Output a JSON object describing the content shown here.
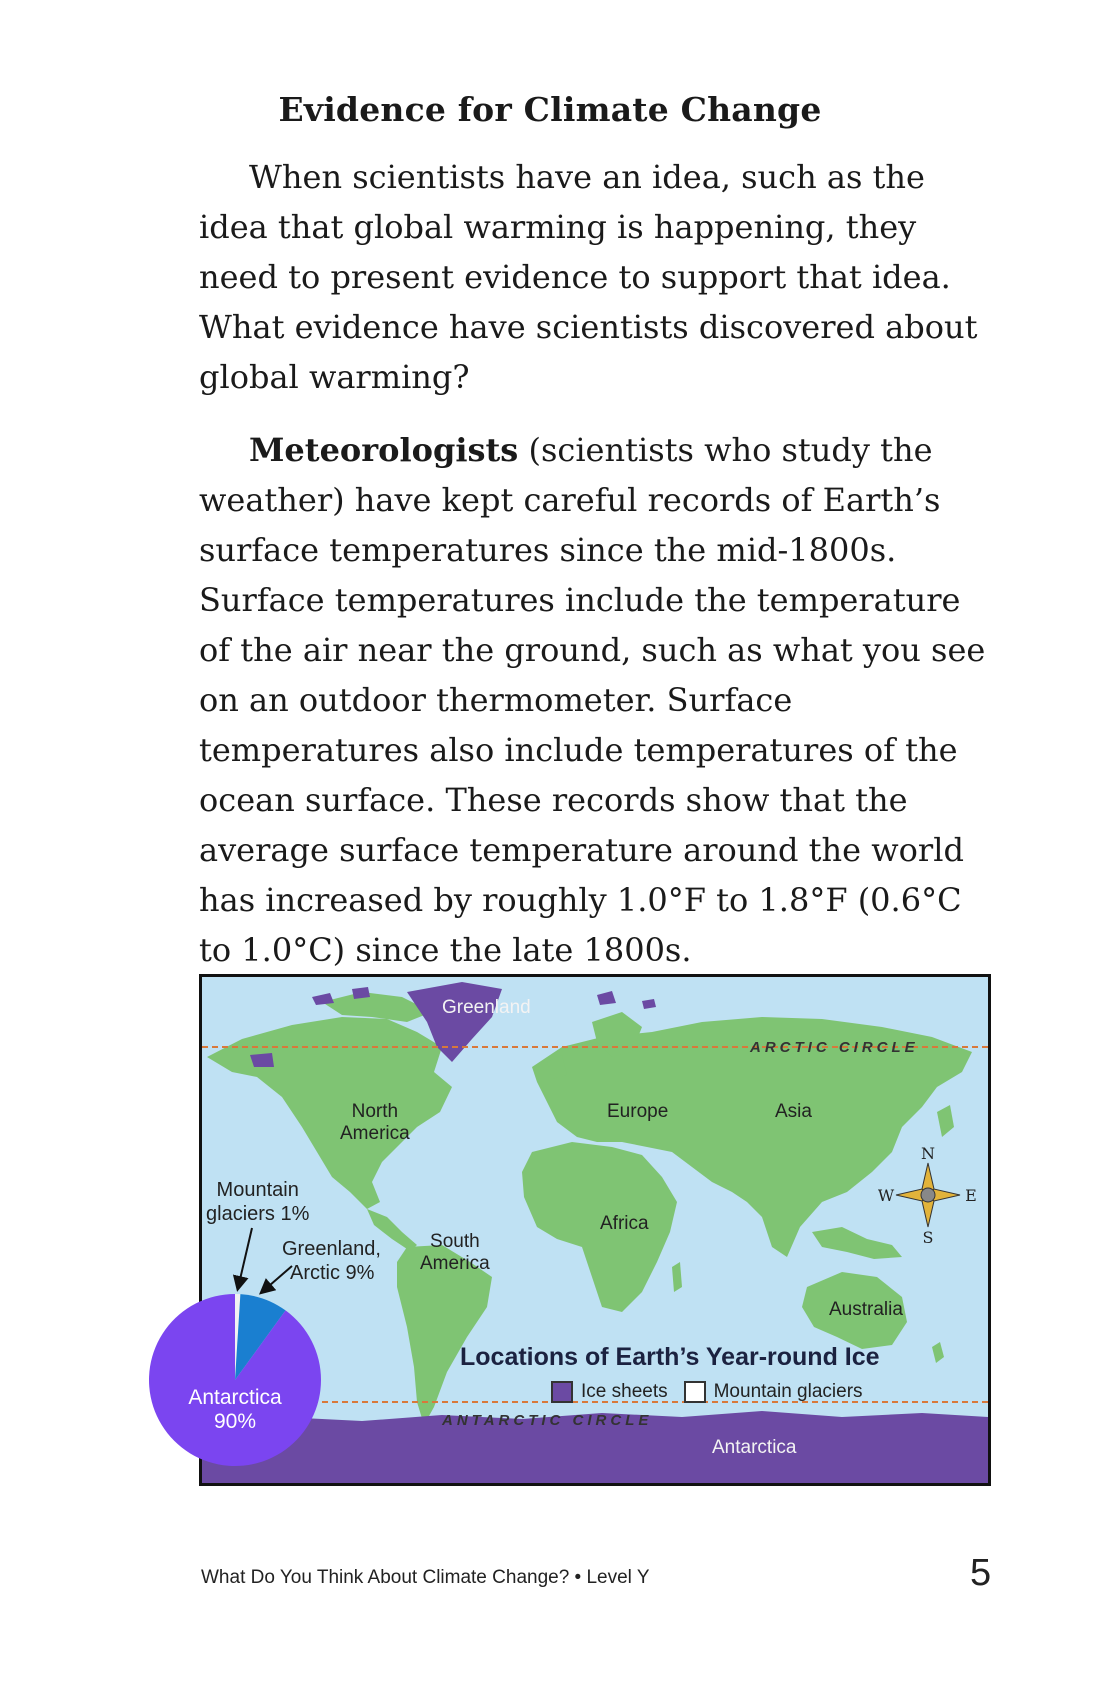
{
  "title": "Evidence for Climate Change",
  "para1": "When scientists have an idea, such as the idea that global warming is happening, they need to present evidence to support that idea. What evidence have scientists discovered about global warming?",
  "para2": {
    "term": "Meteorologists",
    "rest": " (scientists who study the weather) have kept careful records of Earth’s surface temperatures since the mid-1800s. Surface temperatures include the temperature of the air near the ground, such as what you see on an outdoor thermometer. Surface temperatures also include temperatures of the ocean surface. These records show that the average surface temperature around the world has increased by roughly 1.0°F to 1.8°F (0.6°C to 1.0°C) since the late 1800s."
  },
  "map": {
    "title": "Locations of Earth’s Year-round Ice",
    "legend": [
      {
        "label": "Ice sheets",
        "color": "#6b4aa3"
      },
      {
        "label": "Mountain glaciers",
        "color": "#ffffff"
      }
    ],
    "labels": {
      "greenland": "Greenland",
      "arctic_circle": "ARCTIC CIRCLE",
      "antarctic_circle": "ANTARCTIC CIRCLE",
      "north_america_1": "North",
      "north_america_2": "America",
      "south_america_1": "South",
      "south_america_2": "America",
      "europe": "Europe",
      "asia": "Asia",
      "africa": "Africa",
      "australia": "Australia",
      "antarctica": "Antarctica"
    },
    "compass": {
      "n": "N",
      "s": "S",
      "e": "E",
      "w": "W"
    },
    "colors": {
      "ocean": "#bfe1f3",
      "land": "#7fc473",
      "ice": "#6b4aa3",
      "circle_line": "#d9783a"
    }
  },
  "pie": {
    "slices": [
      {
        "label": "Antarctica",
        "value": 90,
        "display": "90%",
        "color": "#7b45f0"
      },
      {
        "label": "Greenland, Arctic",
        "value": 9,
        "display": "9%",
        "color": "#1a7fd0"
      },
      {
        "label": "Mountain glaciers",
        "value": 1,
        "display": "1%",
        "color": "#f2f2f2"
      }
    ],
    "label_glaciers_1": "Mountain",
    "label_glaciers_2": "glaciers 1%",
    "label_arctic_1": "Greenland,",
    "label_arctic_2": "Arctic 9%",
    "label_antarctica_1": "Antarctica",
    "label_antarctica_2": "90%"
  },
  "footer": "What Do You Think About Climate Change? • Level Y",
  "page_number": "5"
}
